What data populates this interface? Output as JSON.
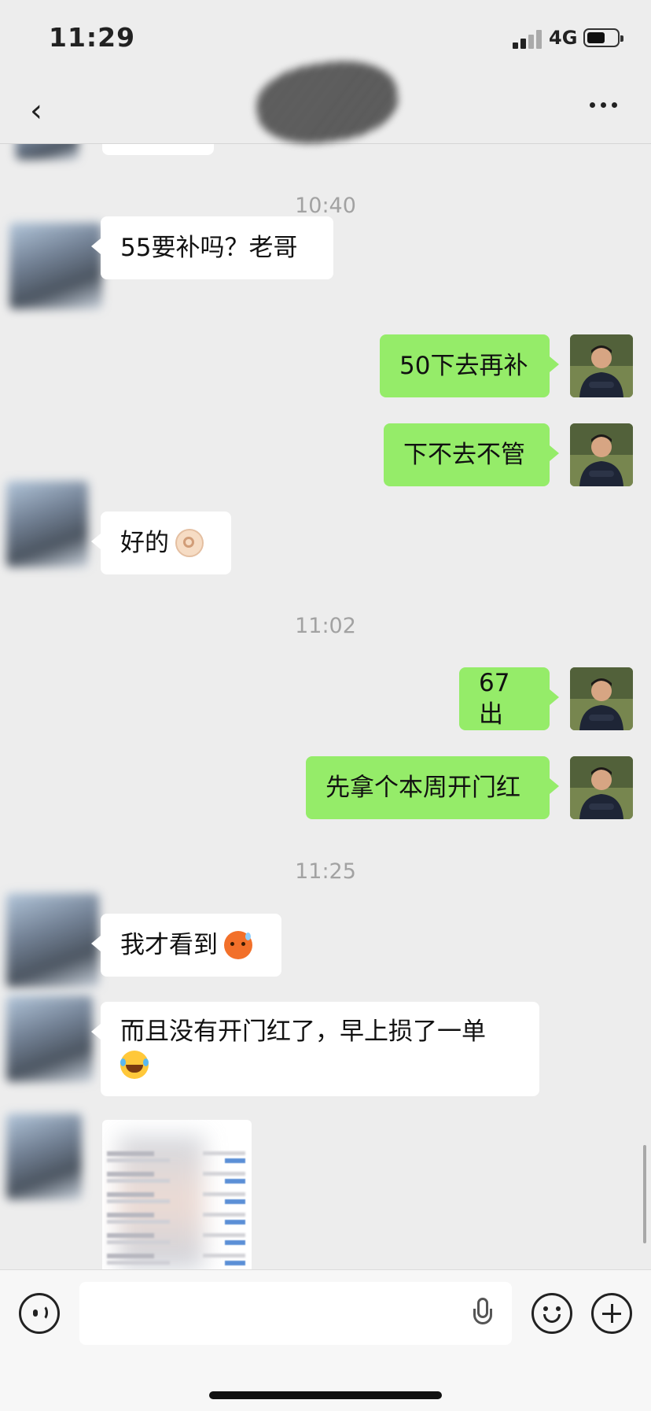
{
  "status_bar": {
    "time": "11:29",
    "network": "4G"
  },
  "nav": {
    "back_icon": "chevron-left-icon",
    "more_icon": "more-dots-icon"
  },
  "messages": {
    "ts_1": "10:40",
    "m1": "55要补吗？老哥",
    "m2": "50下去再补",
    "m3": "下不去不管",
    "m4": "好的",
    "ts_2": "11:02",
    "m5": "67出",
    "m6": "先拿个本周开门红",
    "ts_3": "11:25",
    "m7": "我才看到",
    "m8_line1": "而且没有开门红了，早上损了一单"
  },
  "emoji": {
    "m4": "ok-hand-emoji",
    "m7": "hot-face-emoji",
    "m8": "rolling-laughing-emoji"
  },
  "colors": {
    "self_bubble": "#95ec69",
    "other_bubble": "#ffffff",
    "background": "#ededed"
  }
}
